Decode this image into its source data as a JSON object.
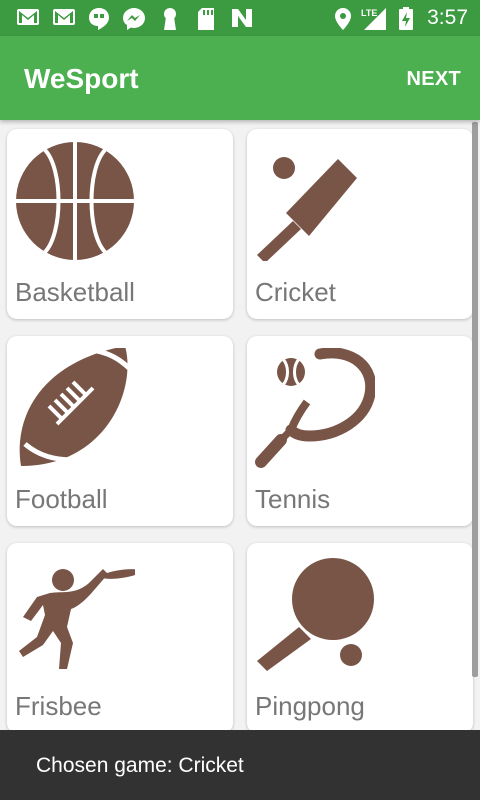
{
  "status_bar": {
    "icons": [
      "gmail-icon",
      "gmail-icon",
      "hangouts-icon",
      "messenger-icon",
      "keyhole-icon",
      "sd-card-icon",
      "n-icon",
      "location-icon",
      "lte-signal-icon",
      "battery-icon"
    ],
    "network": "LTE",
    "time": "3:57"
  },
  "app_bar": {
    "title": "WeSport",
    "action": "NEXT"
  },
  "sports": [
    {
      "label": "Basketball",
      "icon": "basketball-icon"
    },
    {
      "label": "Cricket",
      "icon": "cricket-icon"
    },
    {
      "label": "Football",
      "icon": "football-icon"
    },
    {
      "label": "Tennis",
      "icon": "tennis-icon"
    },
    {
      "label": "Frisbee",
      "icon": "frisbee-icon"
    },
    {
      "label": "Pingpong",
      "icon": "pingpong-icon"
    }
  ],
  "toast": {
    "text": "Chosen game: Cricket"
  },
  "colors": {
    "status_bar": "#3c9a40",
    "app_bar": "#4caf50",
    "icon": "#795548",
    "label": "#777777",
    "toast": "#323232"
  }
}
